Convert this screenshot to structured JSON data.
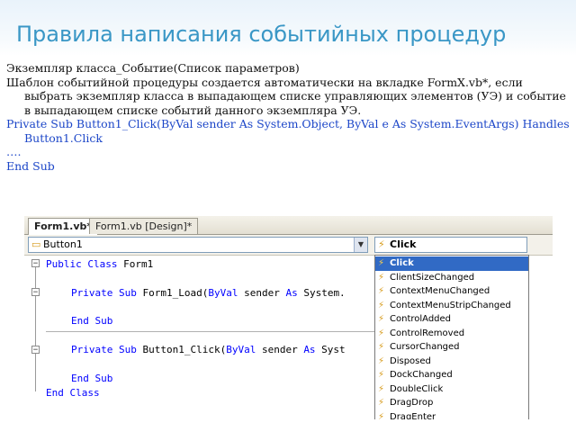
{
  "slide": {
    "title": "Правила написания событийных процедур",
    "lines": [
      "Экземпляр класса_Событие(Список параметров)",
      "Шаблон событийной процедуры создается автоматически на вкладке  FormX.vb*, если выбрать экземпляр класса в выпадающем списке управляющих элементов (УЭ) и событие в выпадающем списке событий данного экземпляра УЭ.",
      "Private Sub Button1_Click(ByVal sender As System.Object, ByVal e As System.EventArgs) Handles Button1.Click",
      "….",
      "End Sub"
    ]
  },
  "ide": {
    "tabs": [
      {
        "label": "Form1.vb*",
        "active": true
      },
      {
        "label": "Form1.vb [Design]*",
        "active": false
      }
    ],
    "object_combo": "Button1",
    "event_combo": "Click",
    "code": {
      "l1_kw": "Public Class",
      "l1_rest": " Form1",
      "l2_kw1": "Private Sub",
      "l2_mid": " Form1_Load(",
      "l2_kw2": "ByVal",
      "l2_mid2": " sender ",
      "l2_kw3": "As",
      "l2_rest": " System.",
      "l3": "End Sub",
      "l4_kw1": "Private Sub",
      "l4_mid": " Button1_Click(",
      "l4_kw2": "ByVal",
      "l4_mid2": " sender ",
      "l4_kw3": "As",
      "l4_rest": " Syst",
      "l5": "End Sub",
      "l6": "End Class"
    },
    "events": [
      "Click",
      "ClientSizeChanged",
      "ContextMenuChanged",
      "ContextMenuStripChanged",
      "ControlAdded",
      "ControlRemoved",
      "CursorChanged",
      "Disposed",
      "DockChanged",
      "DoubleClick",
      "DragDrop",
      "DragEnter"
    ],
    "selected_event": "Click",
    "icons": {
      "event": "lightning-bolt-icon",
      "object": "button-control-icon"
    }
  }
}
